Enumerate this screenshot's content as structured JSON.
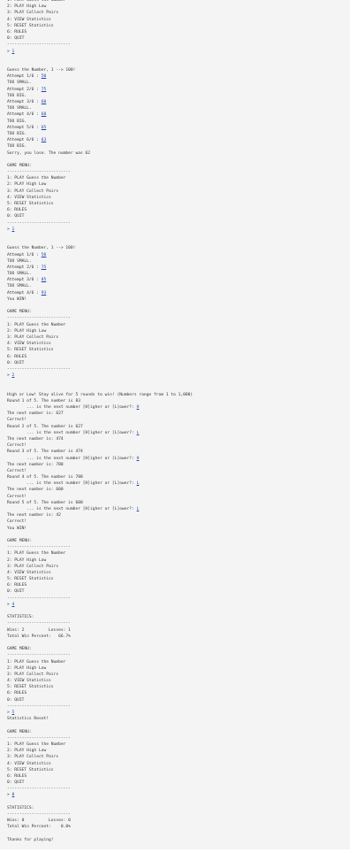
{
  "console": {
    "lines": [
      {
        "t": "1: PLAY Guess the Number"
      },
      {
        "t": "2: PLAY High Low"
      },
      {
        "t": "3: PLAY Collect Pairs"
      },
      {
        "t": "4: VIEW Statistics"
      },
      {
        "t": "5: RESET Statistics"
      },
      {
        "t": "6: RULES"
      },
      {
        "t": "0: QUIT"
      },
      {
        "t": "--------------------------"
      },
      {
        "t": "> ",
        "u": "1"
      },
      {
        "t": ""
      },
      {
        "t": ""
      },
      {
        "t": "Guess the Number, 1 --> 100!"
      },
      {
        "t": "Attempt 1/6 : ",
        "u": "50"
      },
      {
        "t": "TOO SMALL."
      },
      {
        "t": "Attempt 2/6 : ",
        "u": "75"
      },
      {
        "t": "TOO BIG."
      },
      {
        "t": "Attempt 3/6 : ",
        "u": "60"
      },
      {
        "t": "TOO SMALL."
      },
      {
        "t": "Attempt 4/6 : ",
        "u": "68"
      },
      {
        "t": "TOO BIG."
      },
      {
        "t": "Attempt 5/6 : ",
        "u": "65"
      },
      {
        "t": "TOO BIG."
      },
      {
        "t": "Attempt 6/6 : ",
        "u": "63"
      },
      {
        "t": "TOO BIG."
      },
      {
        "t": "Sorry, you lose. The number was 62"
      },
      {
        "t": ""
      },
      {
        "t": "GAME MENU:"
      },
      {
        "t": "--------------------------"
      },
      {
        "t": "1: PLAY Guess the Number"
      },
      {
        "t": "2: PLAY High Low"
      },
      {
        "t": "3: PLAY Collect Pairs"
      },
      {
        "t": "4: VIEW Statistics"
      },
      {
        "t": "5: RESET Statistics"
      },
      {
        "t": "6: RULES"
      },
      {
        "t": "0: QUIT"
      },
      {
        "t": "--------------------------"
      },
      {
        "t": "> ",
        "u": "1"
      },
      {
        "t": ""
      },
      {
        "t": ""
      },
      {
        "t": "Guess the Number, 1 --> 100!"
      },
      {
        "t": "Attempt 1/6 : ",
        "u": "50"
      },
      {
        "t": "TOO SMALL."
      },
      {
        "t": "Attempt 2/6 : ",
        "u": "75"
      },
      {
        "t": "TOO SMALL."
      },
      {
        "t": "Attempt 3/6 : ",
        "u": "85"
      },
      {
        "t": "TOO SMALL."
      },
      {
        "t": "Attempt 4/6 : ",
        "u": "93"
      },
      {
        "t": "You WIN!"
      },
      {
        "t": ""
      },
      {
        "t": "GAME MENU:"
      },
      {
        "t": "--------------------------"
      },
      {
        "t": "1: PLAY Guess the Number"
      },
      {
        "t": "2: PLAY High Low"
      },
      {
        "t": "3: PLAY Collect Pairs"
      },
      {
        "t": "4: VIEW Statistics"
      },
      {
        "t": "5: RESET Statistics"
      },
      {
        "t": "6: RULES"
      },
      {
        "t": "0: QUIT"
      },
      {
        "t": "--------------------------"
      },
      {
        "t": "> ",
        "u": "2"
      },
      {
        "t": ""
      },
      {
        "t": ""
      },
      {
        "t": "High or Low! Stay alive for 5 rounds to win! (Numbers range from 1 to 1,000)"
      },
      {
        "t": "Round 1 of 5. The number is 83"
      },
      {
        "t": "        ... is the next number [H]igher or [L]ower?: ",
        "u": "H"
      },
      {
        "t": "The next number is: 627"
      },
      {
        "t": "Correct!"
      },
      {
        "t": "Round 2 of 5. The number is 627"
      },
      {
        "t": "        ... is the next number [H]igher or [L]ower?: ",
        "u": "L"
      },
      {
        "t": "The next number is: 474"
      },
      {
        "t": "Correct!"
      },
      {
        "t": "Round 3 of 5. The number is 474"
      },
      {
        "t": "        ... is the next number [H]igher or [L]ower?: ",
        "u": "H"
      },
      {
        "t": "The next number is: 788"
      },
      {
        "t": "Correct!"
      },
      {
        "t": "Round 4 of 5. The number is 788"
      },
      {
        "t": "        ... is the next number [H]igher or [L]ower?: ",
        "u": "L"
      },
      {
        "t": "The next number is: 600"
      },
      {
        "t": "Correct!"
      },
      {
        "t": "Round 5 of 5. The number is 600"
      },
      {
        "t": "        ... is the next number [H]igher or [L]ower?: ",
        "u": "L"
      },
      {
        "t": "The next number is: 42"
      },
      {
        "t": "Correct!"
      },
      {
        "t": "You WIN!"
      },
      {
        "t": ""
      },
      {
        "t": "GAME MENU:"
      },
      {
        "t": "--------------------------"
      },
      {
        "t": "1: PLAY Guess the Number"
      },
      {
        "t": "2: PLAY High Low"
      },
      {
        "t": "3: PLAY Collect Pairs"
      },
      {
        "t": "4: VIEW Statistics"
      },
      {
        "t": "5: RESET Statistics"
      },
      {
        "t": "6: RULES"
      },
      {
        "t": "0: QUIT"
      },
      {
        "t": "--------------------------"
      },
      {
        "t": "> ",
        "u": "4"
      },
      {
        "t": ""
      },
      {
        "t": "STATISTICS:"
      },
      {
        "t": "--------------------------"
      },
      {
        "t": "Wins: 2          Losses: 1"
      },
      {
        "t": "Total Win Percent:   66.7%"
      },
      {
        "t": ""
      },
      {
        "t": "GAME MENU:"
      },
      {
        "t": "--------------------------"
      },
      {
        "t": "1: PLAY Guess the Number"
      },
      {
        "t": "2: PLAY High Low"
      },
      {
        "t": "3: PLAY Collect Pairs"
      },
      {
        "t": "4: VIEW Statistics"
      },
      {
        "t": "5: RESET Statistics"
      },
      {
        "t": "6: RULES"
      },
      {
        "t": "0: QUIT"
      },
      {
        "t": "--------------------------"
      },
      {
        "t": "> ",
        "u": "5"
      },
      {
        "t": "Statistics Reset!"
      },
      {
        "t": ""
      },
      {
        "t": "GAME MENU:"
      },
      {
        "t": "--------------------------"
      },
      {
        "t": "1: PLAY Guess the Number"
      },
      {
        "t": "2: PLAY High Low"
      },
      {
        "t": "3: PLAY Collect Pairs"
      },
      {
        "t": "4: VIEW Statistics"
      },
      {
        "t": "5: RESET Statistics"
      },
      {
        "t": "6: RULES"
      },
      {
        "t": "0: QUIT"
      },
      {
        "t": "--------------------------"
      },
      {
        "t": "> ",
        "u": "0"
      },
      {
        "t": ""
      },
      {
        "t": "STATISTICS:"
      },
      {
        "t": "--------------------------"
      },
      {
        "t": "Wins: 0          Losses: 0"
      },
      {
        "t": "Total Win Percent:    0.0%"
      },
      {
        "t": ""
      },
      {
        "t": "Thanks for playing!"
      }
    ]
  },
  "colors": {
    "console_background": "#f4f4f4",
    "text": "#333333",
    "user_input": "#1a3fae"
  }
}
